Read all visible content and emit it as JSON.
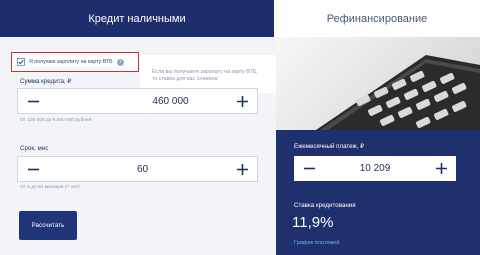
{
  "tabs": [
    {
      "label": "Кредит наличными",
      "active": true
    },
    {
      "label": "Рефинансирование",
      "active": false
    }
  ],
  "salary_checkbox": {
    "label": "Я получаю зарплату на карту ВТБ",
    "checked": true,
    "info_icon": "i"
  },
  "tooltip": {
    "line1": "Если вы получаете зарплату на карту ВТБ,",
    "line2": "то ставка для вас снижена"
  },
  "amount": {
    "label": "Сумма кредита, ₽",
    "value": "460 000",
    "hint": "От 100 000 до 5 000 000 рублей"
  },
  "term": {
    "label": "Срок, мес",
    "value": "60",
    "hint": "От 6 до 84 месяцев (7 лет)"
  },
  "calculate_button": "Рассчитать",
  "payment": {
    "label": "Ежемесячный платеж, ₽",
    "value": "10 209"
  },
  "rate": {
    "label": "Ставка кредитования",
    "value": "11,9%"
  },
  "schedule_link": "График платежей",
  "colors": {
    "brand_navy": "#1e2d6b",
    "highlight_red": "#c8322c",
    "link_blue": "#6fb2e8"
  }
}
